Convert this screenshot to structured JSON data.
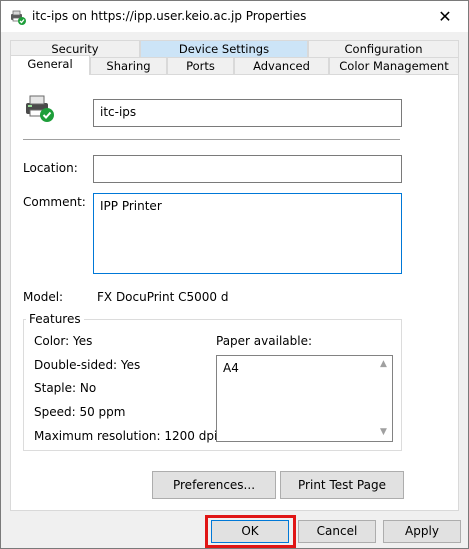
{
  "window": {
    "title": "itc-ips on https://ipp.user.keio.ac.jp Properties",
    "close_glyph": "✕"
  },
  "tabs": {
    "row1": [
      "Security",
      "Device Settings",
      "Configuration"
    ],
    "row2": [
      "General",
      "Sharing",
      "Ports",
      "Advanced",
      "Color Management"
    ],
    "active": "General",
    "highlighted": "Device Settings"
  },
  "general": {
    "printer_name": "itc-ips",
    "location_label": "Location:",
    "location_value": "",
    "comment_label": "Comment:",
    "comment_value": "IPP Printer",
    "model_label": "Model:",
    "model_value": "FX DocuPrint C5000 d",
    "features_title": "Features",
    "features": {
      "color": "Color: Yes",
      "double_sided": "Double-sided: Yes",
      "staple": "Staple: No",
      "speed": "Speed: 50 ppm",
      "max_resolution": "Maximum resolution: 1200 dpi"
    },
    "paper_label": "Paper available:",
    "paper_items": [
      "A4"
    ]
  },
  "buttons": {
    "preferences": "Preferences...",
    "print_test_page": "Print Test Page",
    "ok": "OK",
    "cancel": "Cancel",
    "apply": "Apply"
  },
  "icons": {
    "title_icon": "printer-check-icon",
    "printer_icon": "printer-check-icon",
    "status_color": "#1e9e3a",
    "highlight_color": "#e01515"
  }
}
